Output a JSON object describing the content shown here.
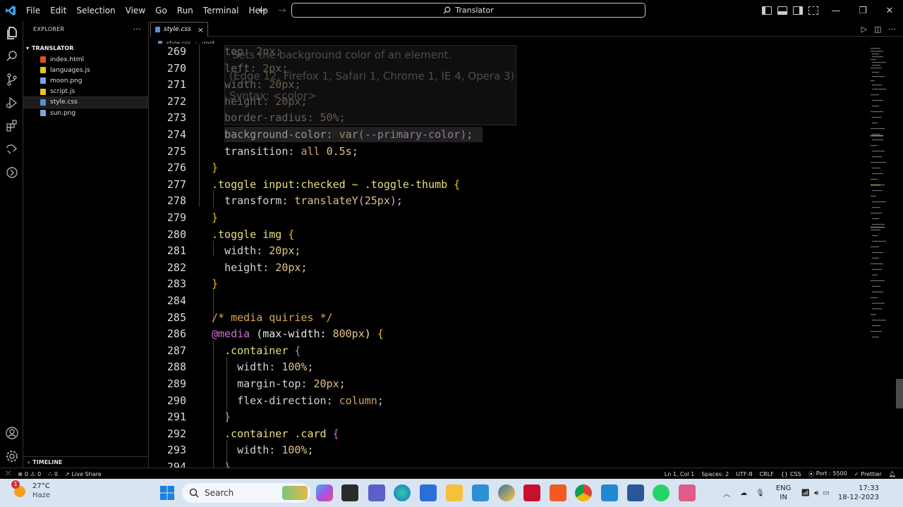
{
  "titlebar": {
    "menu": [
      "File",
      "Edit",
      "Selection",
      "View",
      "Go",
      "Run",
      "Terminal",
      "Help"
    ],
    "search_label": "Translator"
  },
  "sidebar": {
    "title": "EXPLORER",
    "more": "···",
    "folder": "TRANSLATOR",
    "files": [
      {
        "name": "index.html",
        "color": "#e44d26"
      },
      {
        "name": "languages.js",
        "color": "#e8c51b"
      },
      {
        "name": "moon.png",
        "color": "#7aa8d9"
      },
      {
        "name": "script.js",
        "color": "#e8c51b"
      },
      {
        "name": "style.css",
        "color": "#5b8fd6"
      },
      {
        "name": "sun.png",
        "color": "#7aa8d9"
      }
    ],
    "timeline": "TIMELINE"
  },
  "editor": {
    "tab": "style.css",
    "breadcrumb_file": "style.css",
    "breadcrumb_symbol": ":root",
    "hover": {
      "line1": "Sets the background color of an element.",
      "line2": "(Edge 12, Firefox 1, Safari 1, Chrome 1, IE 4, Opera 3)",
      "line3": "Syntax: <color>"
    }
  },
  "statusbar": {
    "errors": "0",
    "warnings": "0",
    "ports": "0",
    "live_share": "Live Share",
    "position": "Ln 1, Col 1",
    "spaces": "Spaces: 2",
    "encoding": "UTF-8",
    "eol": "CRLF",
    "language": "CSS",
    "port": "Port : 5500",
    "prettier": "Prettier"
  },
  "taskbar": {
    "temp": "27°C",
    "weather": "Haze",
    "search": "Search",
    "lang1": "ENG",
    "lang2": "IN",
    "time": "17:33",
    "date": "18-12-2023",
    "notification_count": "1"
  }
}
